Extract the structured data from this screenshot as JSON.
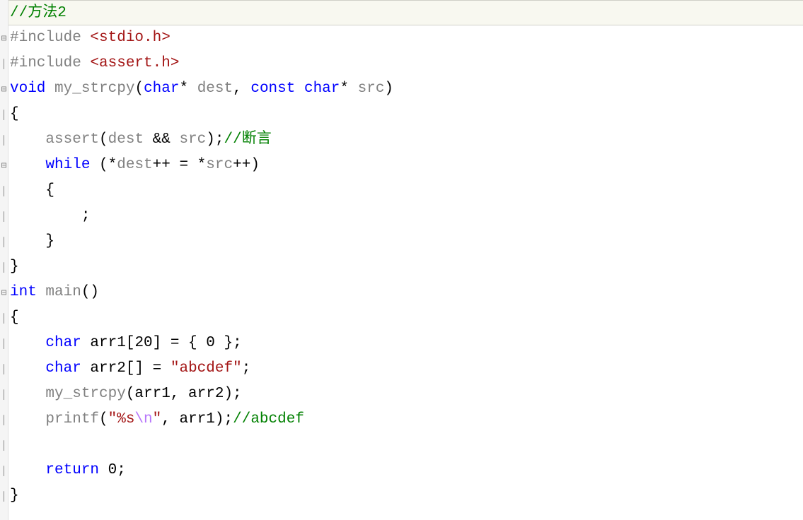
{
  "lines": {
    "l1_comment": "//方法2",
    "l2_include": "#include ",
    "l2_header": "<stdio.h>",
    "l3_include": "#include ",
    "l3_header": "<assert.h>",
    "l4_void": "void",
    "l4_func": " my_strcpy",
    "l4_paren_open": "(",
    "l4_char1": "char",
    "l4_star1": "* ",
    "l4_dest": "dest",
    "l4_comma": ", ",
    "l4_const": "const",
    "l4_space": " ",
    "l4_char2": "char",
    "l4_star2": "* ",
    "l4_src": "src",
    "l4_paren_close": ")",
    "l5_brace": "{",
    "l6_assert": "    assert",
    "l6_paren_open": "(",
    "l6_dest": "dest ",
    "l6_amp": "&& ",
    "l6_src": "src",
    "l6_paren_close": ");",
    "l6_comment": "//断言",
    "l7_while": "    while",
    "l7_space": " ",
    "l7_paren_open": "(",
    "l7_star1": "*",
    "l7_dest": "dest",
    "l7_inc1": "++ = *",
    "l7_src": "src",
    "l7_inc2": "++)",
    "l8_brace": "    {",
    "l9_semi": "        ;",
    "l10_brace": "    }",
    "l11_brace": "}",
    "l12_int": "int",
    "l12_main": " main",
    "l12_parens": "()",
    "l13_brace": "{",
    "l14_char": "    char",
    "l14_arr1": " arr1[20] = { 0 };",
    "l15_char": "    char",
    "l15_arr2": " arr2[] = ",
    "l15_str": "\"abcdef\"",
    "l15_semi": ";",
    "l16_call": "    my_strcpy",
    "l16_args": "(arr1, arr2);",
    "l17_printf": "    printf",
    "l17_paren": "(",
    "l17_str1": "\"%s",
    "l17_esc": "\\n",
    "l17_str2": "\"",
    "l17_rest": ", arr1);",
    "l17_comment": "//abcdef",
    "l18_empty": "",
    "l19_return": "    return",
    "l19_val": " 0;",
    "l20_brace": "}"
  },
  "gutter_markers": {
    "collapse": "⊟",
    "line": "│"
  }
}
